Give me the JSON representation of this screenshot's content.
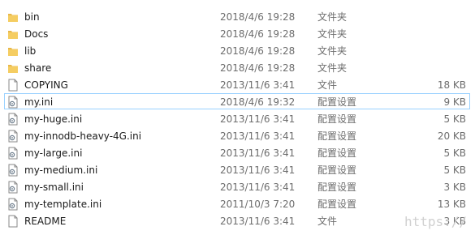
{
  "files": [
    {
      "name": "bin",
      "date": "2018/4/6 19:28",
      "type": "文件夹",
      "size": "",
      "icon": "folder-icon"
    },
    {
      "name": "Docs",
      "date": "2018/4/6 19:28",
      "type": "文件夹",
      "size": "",
      "icon": "folder-icon"
    },
    {
      "name": "lib",
      "date": "2018/4/6 19:28",
      "type": "文件夹",
      "size": "",
      "icon": "folder-icon"
    },
    {
      "name": "share",
      "date": "2018/4/6 19:28",
      "type": "文件夹",
      "size": "",
      "icon": "folder-icon"
    },
    {
      "name": "COPYING",
      "date": "2013/11/6 3:41",
      "type": "文件",
      "size": "18 KB",
      "icon": "file-icon"
    },
    {
      "name": "my.ini",
      "date": "2018/4/6 19:32",
      "type": "配置设置",
      "size": "9 KB",
      "icon": "settings-file-icon",
      "selected": true
    },
    {
      "name": "my-huge.ini",
      "date": "2013/11/6 3:41",
      "type": "配置设置",
      "size": "5 KB",
      "icon": "settings-file-icon"
    },
    {
      "name": "my-innodb-heavy-4G.ini",
      "date": "2013/11/6 3:41",
      "type": "配置设置",
      "size": "20 KB",
      "icon": "settings-file-icon"
    },
    {
      "name": "my-large.ini",
      "date": "2013/11/6 3:41",
      "type": "配置设置",
      "size": "5 KB",
      "icon": "settings-file-icon"
    },
    {
      "name": "my-medium.ini",
      "date": "2013/11/6 3:41",
      "type": "配置设置",
      "size": "5 KB",
      "icon": "settings-file-icon"
    },
    {
      "name": "my-small.ini",
      "date": "2013/11/6 3:41",
      "type": "配置设置",
      "size": "3 KB",
      "icon": "settings-file-icon"
    },
    {
      "name": "my-template.ini",
      "date": "2011/10/3 7:20",
      "type": "配置设置",
      "size": "13 KB",
      "icon": "settings-file-icon"
    },
    {
      "name": "README",
      "date": "2013/11/6 3:41",
      "type": "文件",
      "size": "3 KB",
      "icon": "file-icon"
    }
  ],
  "watermark": "https://",
  "colors": {
    "folder": "#e8b84a",
    "selection_border": "#99d1ff"
  }
}
